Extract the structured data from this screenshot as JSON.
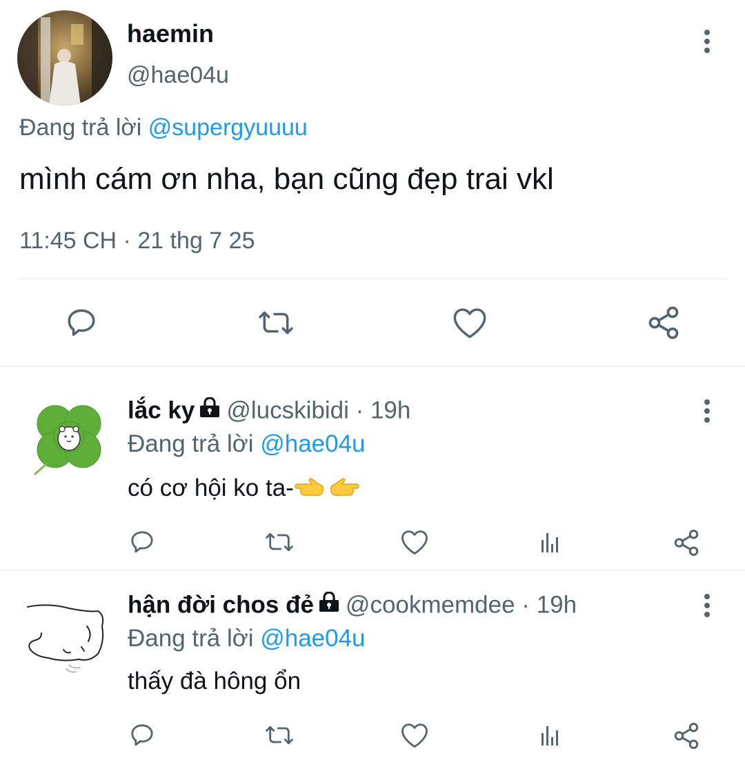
{
  "main_tweet": {
    "display_name": "haemin",
    "handle": "@hae04u",
    "reply_prefix": "Đang trả lời",
    "reply_to": "@supergyuuuu",
    "text": "mình cám ơn nha, bạn cũng đẹp trai vkl",
    "timestamp": "11:45 CH · 21 thg 7 25",
    "actions": [
      "reply-icon",
      "retweet-icon",
      "like-icon",
      "share-icon"
    ]
  },
  "replies": [
    {
      "display_name": "lắc ky",
      "protected": true,
      "handle": "@lucskibidi",
      "sep": "·",
      "time": "19h",
      "reply_prefix": "Đang trả lời",
      "reply_to": "@hae04u",
      "text": "có cơ hội ko ta-",
      "emojis": [
        "pointing-right-emoji",
        "pointing-left-emoji"
      ],
      "avatar": "four-leaf-clover-avatar",
      "actions": [
        "reply-icon",
        "retweet-icon",
        "like-icon",
        "analytics-icon",
        "share-icon"
      ]
    },
    {
      "display_name": "hận đời chos đẻ",
      "protected": true,
      "handle": "@cookmemdee",
      "sep": "·",
      "time": "19h",
      "reply_prefix": "Đang trả lời",
      "reply_to": "@hae04u",
      "text": "thấy đà hông ổn",
      "avatar": "sketch-dog-avatar",
      "actions": [
        "reply-icon",
        "retweet-icon",
        "like-icon",
        "analytics-icon",
        "share-icon"
      ]
    }
  ],
  "colors": {
    "text": "#0f1419",
    "secondary": "#536471",
    "link": "#1d9bf0",
    "divider": "#eff3f4"
  }
}
